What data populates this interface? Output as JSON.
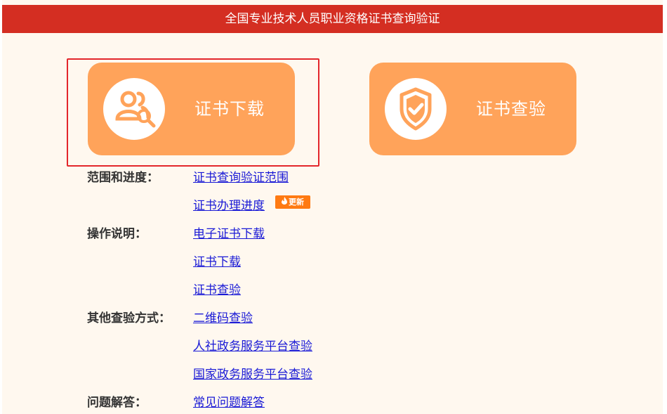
{
  "header": {
    "title": "全国专业技术人员职业资格证书查询验证"
  },
  "cards": {
    "download": {
      "label": "证书下载",
      "icon": "user-search-icon"
    },
    "verify": {
      "label": "证书查验",
      "icon": "shield-check-icon"
    }
  },
  "sections": {
    "scope": {
      "label": "范围和进度：",
      "links": [
        "证书查询验证范围",
        "证书办理进度"
      ],
      "badge": "更新"
    },
    "instructions": {
      "label": "操作说明：",
      "links": [
        "电子证书下载",
        "证书下载",
        "证书查验"
      ]
    },
    "other": {
      "label": "其他查验方式：",
      "links": [
        "二维码查验",
        "人社政务服务平台查验",
        "国家政务服务平台查验"
      ]
    },
    "faq": {
      "label": "问题解答：",
      "links": [
        "常见问题解答"
      ]
    }
  },
  "colors": {
    "header_bg": "#d42e22",
    "card_bg": "#ffa35a",
    "panel_bg": "#fff8ef",
    "link": "#1a1ad6",
    "highlight": "#e3262b",
    "badge_bg": "#ff7a12"
  }
}
